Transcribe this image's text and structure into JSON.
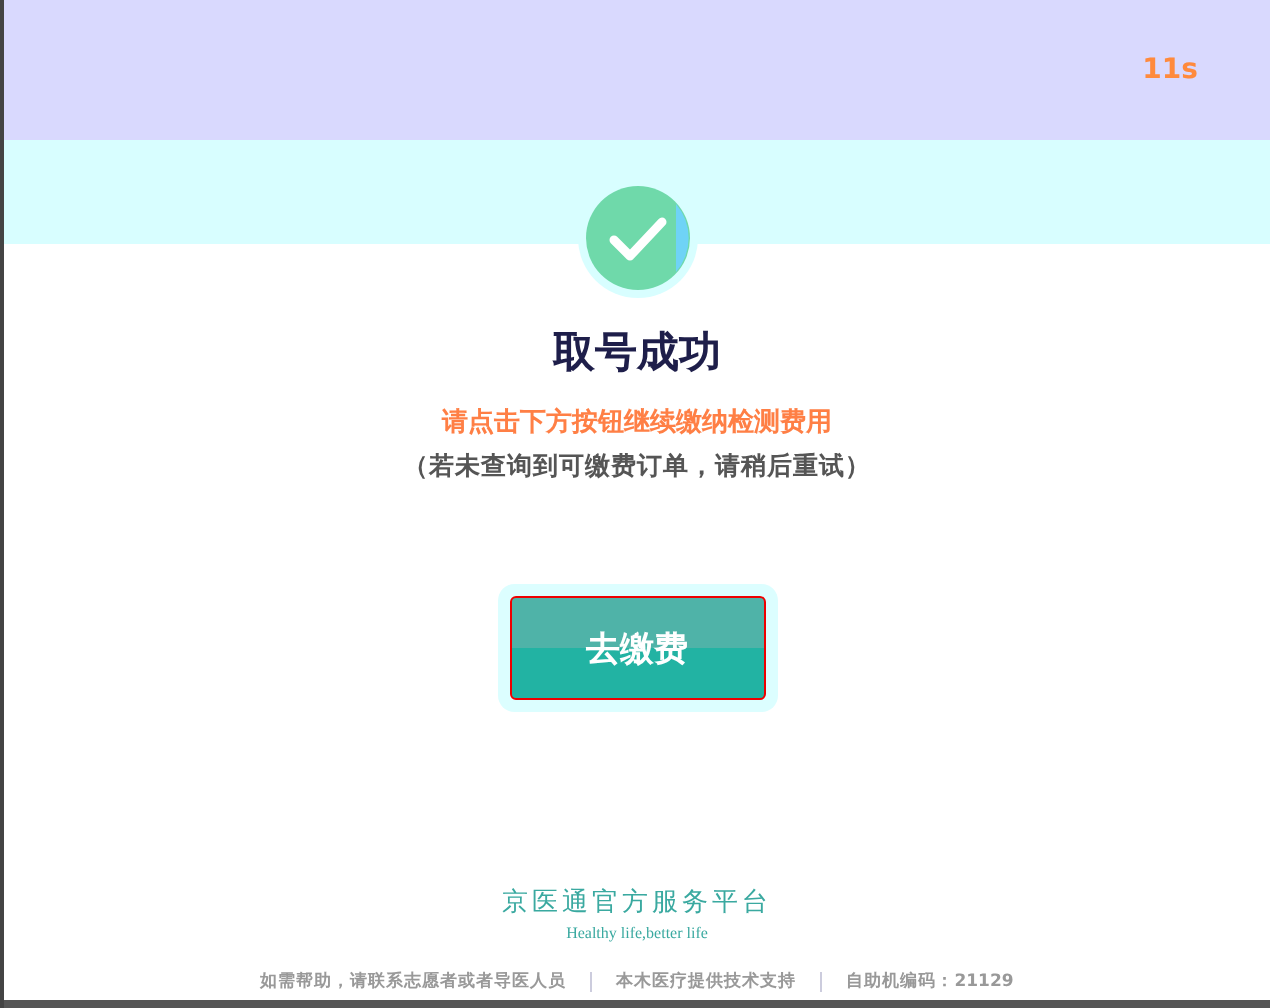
{
  "countdown": "11s",
  "title": "取号成功",
  "instruction": "请点击下方按钮继续缴纳检测费用",
  "note": "（若未查询到可缴费订单，请稍后重试）",
  "pay_button": {
    "label": "去缴费"
  },
  "brand": {
    "name": "京医通官方服务平台",
    "slogan": "Healthy life,better life"
  },
  "footer": [
    "如需帮助，请联系志愿者或者导医人员",
    "本木医疗提供技术支持",
    "自助机编码：21129"
  ]
}
